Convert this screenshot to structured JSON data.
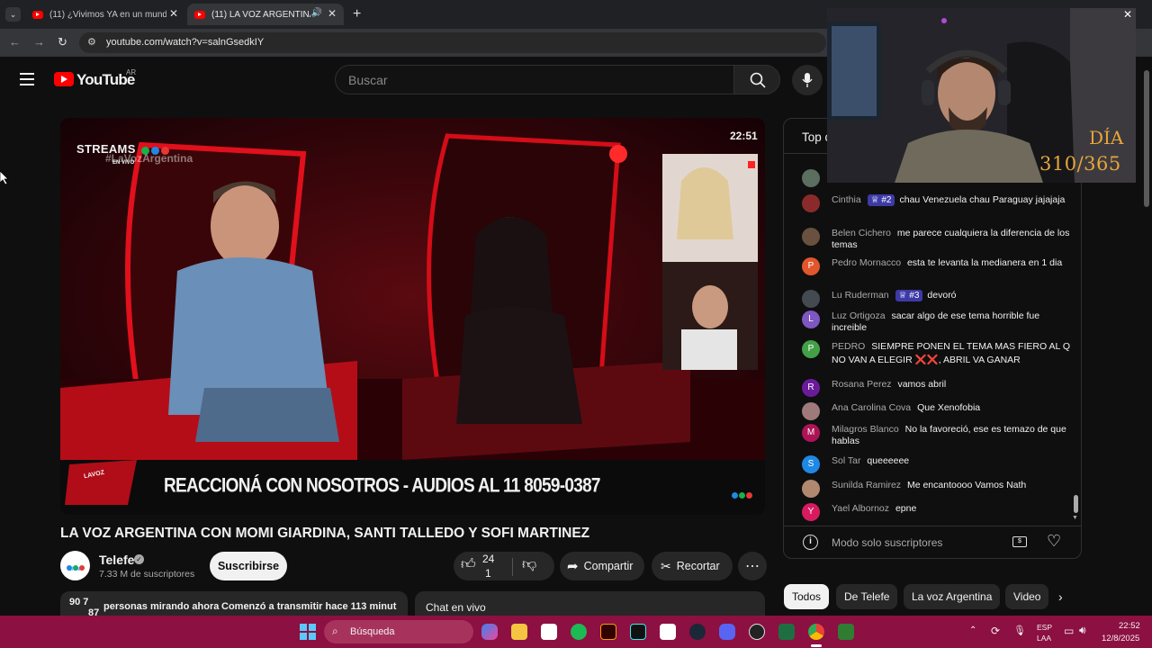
{
  "browser": {
    "tabs": [
      {
        "title": "(11) ¿Vivimos YA en un mundo"
      },
      {
        "title": "(11) LA VOZ ARGENTINA C"
      }
    ],
    "url": "youtube.com/watch?v=salnGsedkIY"
  },
  "youtube": {
    "logo_text": "YouTube",
    "region": "AR",
    "search_placeholder": "Buscar"
  },
  "video": {
    "overlay_brand": "STREAMS",
    "overlay_hashtag": "#LaVozArgentina",
    "overlay_live": "EN VIVO",
    "overlay_time": "22:51",
    "lower_third": "REACCIONÁ CON NOSOTROS - AUDIOS AL 11 8059-0387",
    "corner_logo": "LAVOZ",
    "title": "LA VOZ ARGENTINA CON MOMI GIARDINA, SANTI TALLEDO Y SOFI MARTINEZ"
  },
  "channel": {
    "name": "Telefe",
    "subscribers": "7.33 M de suscriptores",
    "subscribe_label": "Suscribirse",
    "avatar_text": "telefe"
  },
  "actions": {
    "likes_top": "24",
    "likes_bottom": "1",
    "share_label": "Compartir",
    "clip_label": "Recortar"
  },
  "description": {
    "viewers_prefix": "90 7",
    "viewers_text": "personas mirando ahora",
    "started_text": "Comenzó a transmitir hace 113 minut",
    "sub_count": "87"
  },
  "chat_header": {
    "top_label": "Top c",
    "live_chat_label": "Chat en vivo"
  },
  "chat_messages": [
    {
      "name": "Cinthia",
      "badge": "#2",
      "text": "chau Venezuela chau Paraguay jajajaja",
      "avatar": "",
      "color": "#8b2a2a"
    },
    {
      "name": "Belen Cichero",
      "badge": "",
      "text": "me parece cualquiera la diferencia de los temas",
      "avatar": "",
      "color": "#6a5040"
    },
    {
      "name": "Pedro Mornacco",
      "badge": "",
      "text": "esta te levanta la medianera en 1 dia",
      "avatar": "P",
      "color": "#e0562d"
    },
    {
      "name": "Lu Ruderman",
      "badge": "#3",
      "text": "devoró",
      "avatar": "",
      "color": "#444a52"
    },
    {
      "name": "Luz Ortigoza",
      "badge": "",
      "text": "sacar algo de ese tema horrible fue increible",
      "avatar": "L",
      "color": "#7e57c2"
    },
    {
      "name": "PEDRO",
      "badge": "",
      "text": "SIEMPRE PONEN EL TEMA MAS FIERO AL Q NO VAN A ELEGIR ❌❌, ABRIL VA GANAR",
      "avatar": "P",
      "color": "#43a047"
    },
    {
      "name": "Rosana Perez",
      "badge": "",
      "text": "vamos abril",
      "avatar": "R",
      "color": "#6a1b9a"
    },
    {
      "name": "Ana Carolina Cova",
      "badge": "",
      "text": "Que Xenofobia",
      "avatar": "",
      "color": "#9e7a7a"
    },
    {
      "name": "Milagros Blanco",
      "badge": "",
      "text": "No la favoreció, ese es temazo de que hablas",
      "avatar": "M",
      "color": "#ad1457"
    },
    {
      "name": "Sol Tar",
      "badge": "",
      "text": "queeeeee",
      "avatar": "S",
      "color": "#1e88e5"
    },
    {
      "name": "Sunilda Ramirez",
      "badge": "",
      "text": "Me encantoooo Vamos Nath",
      "avatar": "",
      "color": "#b08870"
    },
    {
      "name": "Yael Albornoz",
      "badge": "",
      "text": "epne",
      "avatar": "Y",
      "color": "#d81b60"
    }
  ],
  "chat_footer": {
    "mode_text": "Modo solo suscriptores"
  },
  "chips": [
    "Todos",
    "De Telefe",
    "La voz Argentina",
    "Video"
  ],
  "webcam": {
    "day_label": "DÍA",
    "day_count": "310/365"
  },
  "taskbar": {
    "search_label": "Búsqueda",
    "lang_top": "ESP",
    "lang_bottom": "LAA",
    "time": "22:52",
    "date": "12/8/2025"
  },
  "colors": {
    "youtube_red": "#ff0000",
    "taskbar": "#8c1041",
    "chat_badge": "#3d3aa8"
  }
}
